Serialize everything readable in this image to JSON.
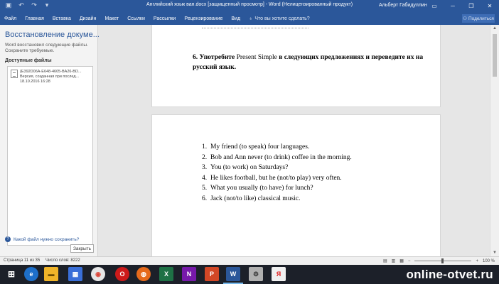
{
  "titlebar": {
    "title": "Английский язык ван.docx [защищенный просмотр]  -  Word (Нелицензированный продукт)",
    "user": "Альберт Габидуллин"
  },
  "ribbon": {
    "tabs": [
      "Файл",
      "Главная",
      "Вставка",
      "Дизайн",
      "Макет",
      "Ссылки",
      "Рассылки",
      "Рецензирование",
      "Вид"
    ],
    "tell_me_placeholder": "Что вы хотите сделать?",
    "share_label": "Поделиться"
  },
  "recovery": {
    "title": "Восстановление докуме...",
    "description": "Word восстановил следующие файлы. Сохраните требуемые.",
    "available_label": "Доступные файлы",
    "item": {
      "name": "{E392D06A-E648-4605-BA26-BD...",
      "version": "Версия, созданная при послед...",
      "date": "18.10.2016 16:28"
    },
    "help_link": "Какой файл нужно сохранить?",
    "close_button": "Закрыть"
  },
  "document": {
    "task": {
      "number": "6.",
      "verb": "Употребите",
      "tense": "Present Simple",
      "rest": "в следующих предложениях и переведите их на русский язык."
    },
    "exercises": [
      {
        "num": "1.",
        "text": "My friend (to speak) four languages."
      },
      {
        "num": "2.",
        "text": "Bob and Ann never (to drink) coffee in the morning."
      },
      {
        "num": "3.",
        "text": "You (to work) on Saturdays?"
      },
      {
        "num": "4.",
        "text": "He likes football, but he (not/to play) very often."
      },
      {
        "num": "5.",
        "text": "What you usually (to have) for lunch?"
      },
      {
        "num": "6.",
        "text": "Jack (not/to like) classical music."
      }
    ]
  },
  "statusbar": {
    "page": "Страница 11 из 35",
    "words": "Число слов: 8222",
    "zoom": "100 %"
  },
  "taskbar": {
    "watermark": "online-otvet.ru",
    "excel_letter": "X",
    "onenote_letter": "N",
    "powerpoint_letter": "P",
    "word_letter": "W",
    "yandex_letter": "Я"
  },
  "colors": {
    "word_blue": "#2b579a",
    "taskbar": "#1c2029"
  }
}
